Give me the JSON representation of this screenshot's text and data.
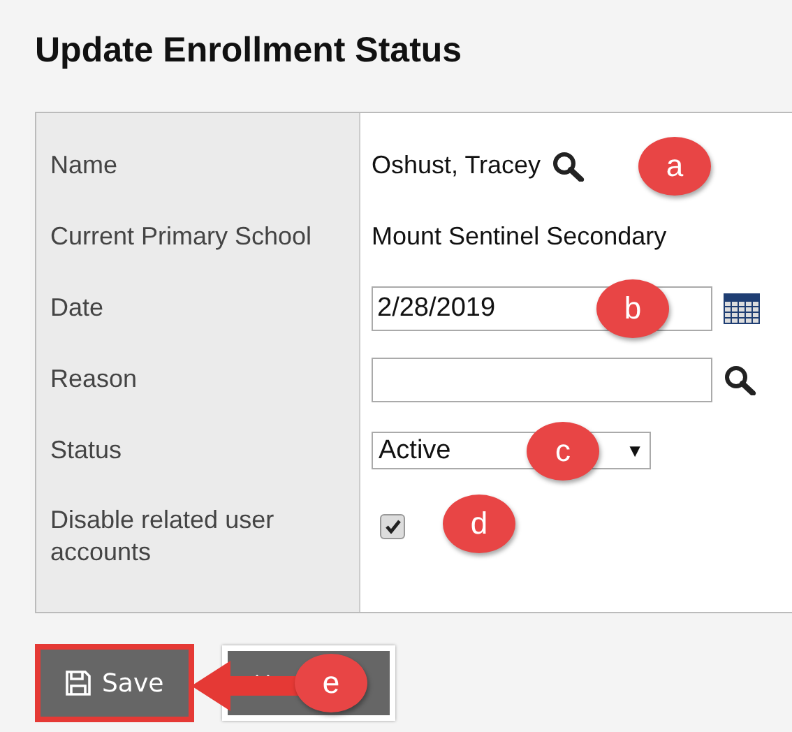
{
  "title": "Update Enrollment Status",
  "fields": [
    {
      "label": "Name",
      "kind": "lookup",
      "value": "Oshust, Tracey",
      "callout": "a"
    },
    {
      "label": "Current Primary School",
      "kind": "text",
      "value": "Mount Sentinel Secondary"
    },
    {
      "label": "Date",
      "kind": "date",
      "value": "2/28/2019",
      "callout": "b"
    },
    {
      "label": "Reason",
      "kind": "search"
    },
    {
      "label": "Status",
      "kind": "select",
      "value": "Active",
      "caret": "▼",
      "callout": "c"
    },
    {
      "label": "Disable related user accounts",
      "kind": "checkbox",
      "checked": true,
      "callout": "d"
    }
  ],
  "buttons": [
    {
      "kind": "save",
      "label": "Save",
      "highlighted": true
    },
    {
      "kind": "cancel",
      "highlighted": false
    }
  ],
  "button_callout": "e"
}
